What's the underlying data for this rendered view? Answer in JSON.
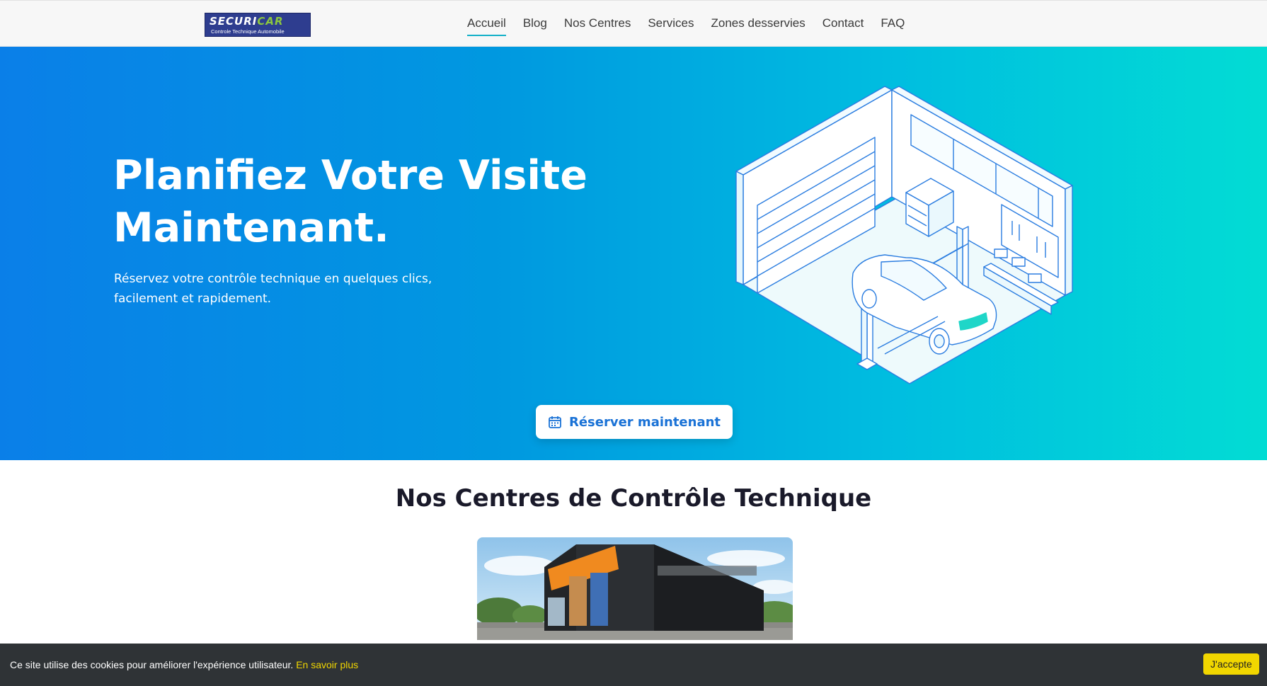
{
  "brand": {
    "name_part1": "SECURI",
    "name_part2": "CAR",
    "tagline": "Controle Technique Automobile"
  },
  "nav": {
    "items": [
      {
        "label": "Accueil",
        "active": true
      },
      {
        "label": "Blog"
      },
      {
        "label": "Nos Centres"
      },
      {
        "label": "Services"
      },
      {
        "label": "Zones desservies"
      },
      {
        "label": "Contact"
      },
      {
        "label": "FAQ"
      }
    ]
  },
  "hero": {
    "title": "Planifiez Votre Visite Maintenant.",
    "subtitle": "Réservez votre contrôle technique en quelques clics, facilement et rapidement.",
    "cta_label": "Réserver maintenant",
    "cta_icon": "calendar-icon",
    "illustration": "garage-car-lift-illustration"
  },
  "centers": {
    "title": "Nos Centres de Contrôle Technique",
    "image": "controle-technique-building-photo"
  },
  "cookie": {
    "text": "Ce site utilise des cookies pour améliorer l'expérience utilisateur.",
    "link_label": "En savoir plus",
    "accept_label": "J'accepte"
  },
  "colors": {
    "hero_start": "#0a7fe8",
    "hero_end": "#02dcd4",
    "brand_blue": "#2e3d8f",
    "brand_green": "#8cc63f",
    "cta_text": "#1a72d6",
    "cookie_bg": "#2f3336",
    "cookie_accent": "#f1d600",
    "nav_active_underline": "#12b0c8"
  }
}
